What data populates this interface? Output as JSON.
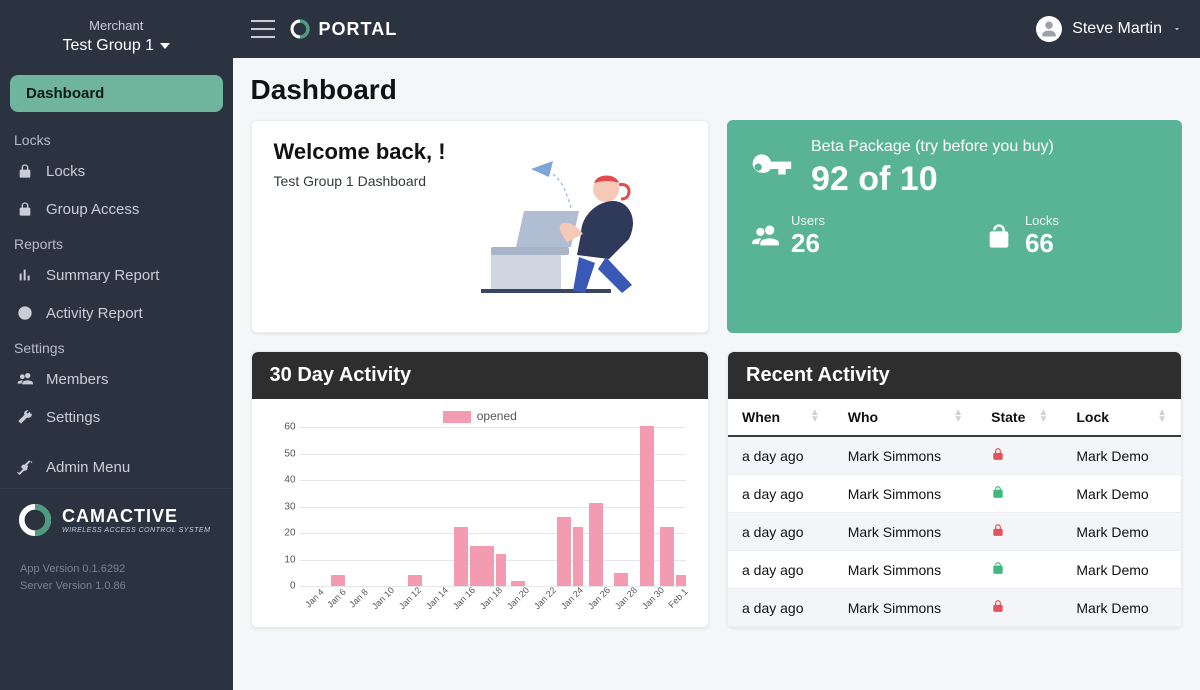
{
  "sidebar": {
    "merchant_label": "Merchant",
    "merchant_group": "Test Group 1",
    "items": [
      {
        "label": "Dashboard",
        "active": true
      },
      {
        "section": "Locks"
      },
      {
        "label": "Locks"
      },
      {
        "label": "Group Access"
      },
      {
        "section": "Reports"
      },
      {
        "label": "Summary Report"
      },
      {
        "label": "Activity Report"
      },
      {
        "section": "Settings"
      },
      {
        "label": "Members"
      },
      {
        "label": "Settings"
      },
      {
        "label": "Admin Menu"
      }
    ],
    "brand_name": "CAMACTIVE",
    "brand_tag": "WIRELESS ACCESS CONTROL SYSTEM",
    "app_version": "App Version 0.1.6292",
    "server_version": "Server Version 1.0.86"
  },
  "topbar": {
    "portal": "PORTAL",
    "user_name": "Steve Martin"
  },
  "page": {
    "title": "Dashboard"
  },
  "welcome": {
    "heading": "Welcome back, !",
    "sub": "Test Group 1 Dashboard"
  },
  "package": {
    "name": "Beta Package (try before you buy)",
    "count": "92 of 10",
    "users_label": "Users",
    "users_value": "26",
    "locks_label": "Locks",
    "locks_value": "66"
  },
  "panels": {
    "chart_title": "30 Day Activity",
    "recent_title": "Recent Activity"
  },
  "recent": {
    "cols": {
      "when": "When",
      "who": "Who",
      "state": "State",
      "lock": "Lock"
    },
    "rows": [
      {
        "when": "a day ago",
        "who": "Mark Simmons",
        "state": "locked",
        "lock": "Mark Demo"
      },
      {
        "when": "a day ago",
        "who": "Mark Simmons",
        "state": "unlocked",
        "lock": "Mark Demo"
      },
      {
        "when": "a day ago",
        "who": "Mark Simmons",
        "state": "locked",
        "lock": "Mark Demo"
      },
      {
        "when": "a day ago",
        "who": "Mark Simmons",
        "state": "unlocked",
        "lock": "Mark Demo"
      },
      {
        "when": "a day ago",
        "who": "Mark Simmons",
        "state": "locked",
        "lock": "Mark Demo"
      }
    ]
  },
  "chart_data": {
    "type": "bar",
    "title": "30 Day Activity",
    "legend": "opened",
    "xlabel": "",
    "ylabel": "",
    "ylim": [
      0,
      60
    ],
    "yticks": [
      0,
      10,
      20,
      30,
      40,
      50,
      60
    ],
    "categories": [
      "Jan 4",
      "Jan 6",
      "Jan 8",
      "Jan 10",
      "Jan 12",
      "Jan 14",
      "Jan 16",
      "Jan 18",
      "Jan 20",
      "Jan 22",
      "Jan 24",
      "Jan 26",
      "Jan 28",
      "Jan 30",
      "Feb 1"
    ],
    "values": [
      0,
      4,
      0,
      0,
      4,
      0,
      22,
      15,
      2,
      0,
      26,
      31,
      5,
      60,
      22
    ],
    "secondary": [
      0,
      0,
      0,
      0,
      0,
      0,
      15,
      12,
      0,
      0,
      22,
      0,
      0,
      0,
      4
    ],
    "color": "#f39bb0"
  }
}
